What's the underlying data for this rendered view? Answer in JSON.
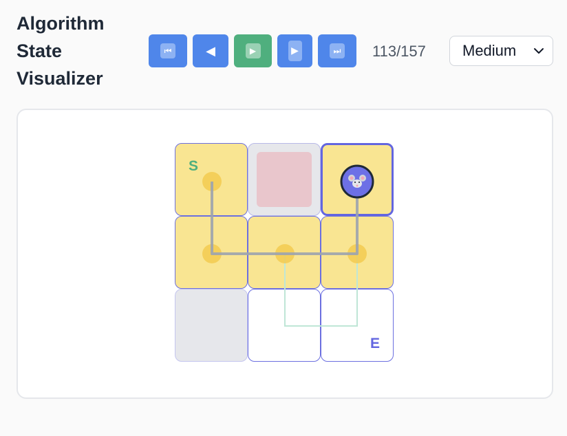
{
  "header": {
    "title": "Algorithm State Visualizer",
    "step_counter": "113/157",
    "speed_select": {
      "value": "Medium"
    }
  },
  "controls": [
    {
      "name": "first-step-button",
      "icon": "fast-backward-icon",
      "glyph": "⏮"
    },
    {
      "name": "prev-step-button",
      "icon": "step-back-icon",
      "glyph": "◀"
    },
    {
      "name": "play-button",
      "icon": "play-icon",
      "glyph": "▶"
    },
    {
      "name": "next-step-button",
      "icon": "step-forward-icon",
      "glyph": "▶"
    },
    {
      "name": "last-step-button",
      "icon": "fast-forward-icon",
      "glyph": "⏭"
    }
  ],
  "grid": {
    "rows": 3,
    "cols": 3,
    "start_label": "S",
    "end_label": "E",
    "agent_icon": "mouse-icon",
    "cells": [
      [
        "visited",
        "wall",
        "current"
      ],
      [
        "visited",
        "visited",
        "visited"
      ],
      [
        "blocked",
        "empty",
        "empty"
      ]
    ]
  },
  "colors": {
    "accent": "#4f86ea",
    "play": "#4faf7e",
    "visited": "#f9e592",
    "path": "#9ca3af",
    "explored_path": "#bfe6d6",
    "cell_border": "#6366e0"
  }
}
